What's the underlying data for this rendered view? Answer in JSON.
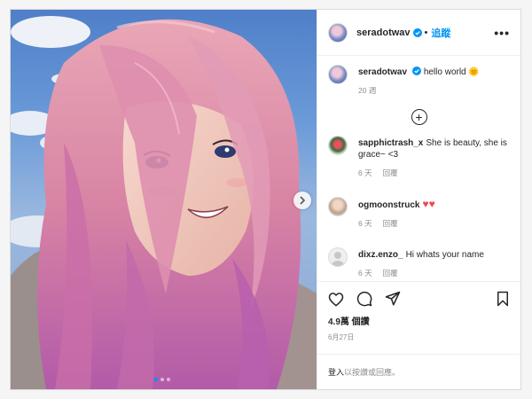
{
  "post": {
    "author": "seradotwav",
    "follow_label": "追蹤",
    "bullet": "•",
    "more_label": "•••",
    "caption_text": "hello world",
    "caption_emoji": "🌞",
    "caption_age": "20 週",
    "load_more_label": "+"
  },
  "comments": [
    {
      "user": "sapphictrash_x",
      "text": "She is beauty, she is grace~ <3",
      "age": "6 天",
      "reply_label": "回覆"
    },
    {
      "user": "ogmoonstruck",
      "text": "♥♥",
      "age": "6 天",
      "reply_label": "回覆"
    },
    {
      "user": "dixz.enzo_",
      "text": "Hi whats your name",
      "age": "6 天",
      "reply_label": "回覆"
    }
  ],
  "stats": {
    "likes": "4.9萬 個讚",
    "date": "6月27日"
  },
  "footer": {
    "login_link": "登入",
    "login_rest": " 以按讚或回應。"
  },
  "icons": {
    "verified": "verified-badge-icon",
    "like": "heart-icon",
    "comment": "comment-bubble-icon",
    "share": "paper-plane-icon",
    "save": "bookmark-icon",
    "next": "chevron-right-icon"
  },
  "colors": {
    "link_blue": "#0095f6",
    "heart_red": "#ed4956",
    "text": "#262626",
    "muted": "#8e8e8e"
  },
  "carousel": {
    "slides": 3,
    "active": 1
  }
}
